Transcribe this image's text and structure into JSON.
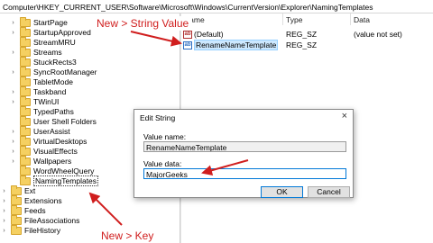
{
  "address_bar": "Computer\\HKEY_CURRENT_USER\\Software\\Microsoft\\Windows\\CurrentVersion\\Explorer\\NamingTemplates",
  "tree": {
    "items": [
      {
        "label": "StartPage",
        "caret": "›"
      },
      {
        "label": "StartupApproved",
        "caret": "›"
      },
      {
        "label": "StreamMRU",
        "caret": ""
      },
      {
        "label": "Streams",
        "caret": "›"
      },
      {
        "label": "StuckRects3",
        "caret": ""
      },
      {
        "label": "SyncRootManager",
        "caret": "›"
      },
      {
        "label": "TabletMode",
        "caret": ""
      },
      {
        "label": "Taskband",
        "caret": "›"
      },
      {
        "label": "TWinUI",
        "caret": "›"
      },
      {
        "label": "TypedPaths",
        "caret": ""
      },
      {
        "label": "User Shell Folders",
        "caret": ""
      },
      {
        "label": "UserAssist",
        "caret": "›"
      },
      {
        "label": "VirtualDesktops",
        "caret": "›"
      },
      {
        "label": "VisualEffects",
        "caret": "›"
      },
      {
        "label": "Wallpapers",
        "caret": "›"
      },
      {
        "label": "WordWheelQuery",
        "caret": ""
      },
      {
        "label": "NamingTemplates",
        "caret": "",
        "selected": true
      },
      {
        "label": "Ext",
        "caret": "›"
      },
      {
        "label": "Extensions",
        "caret": "›"
      },
      {
        "label": "Feeds",
        "caret": "›"
      },
      {
        "label": "FileAssociations",
        "caret": "›"
      },
      {
        "label": "FileHistory",
        "caret": "›"
      }
    ]
  },
  "values_pane": {
    "columns": [
      "Name",
      "Type",
      "Data"
    ],
    "rows": [
      {
        "icon": "ab",
        "name": "(Default)",
        "type": "REG_SZ",
        "data": "(value not set)"
      },
      {
        "icon": "ab",
        "name": "RenameNameTemplate",
        "type": "REG_SZ",
        "data": ""
      }
    ]
  },
  "dialog": {
    "title": "Edit String",
    "close_glyph": "×",
    "value_name_label": "Value name:",
    "value_name": "RenameNameTemplate",
    "value_data_label": "Value data:",
    "value_data": "MajorGeeks",
    "ok_label": "OK",
    "cancel_label": "Cancel"
  },
  "annotations": {
    "string_value": "New > String Value",
    "key": "New > Key",
    "color": "#d01e1e"
  }
}
